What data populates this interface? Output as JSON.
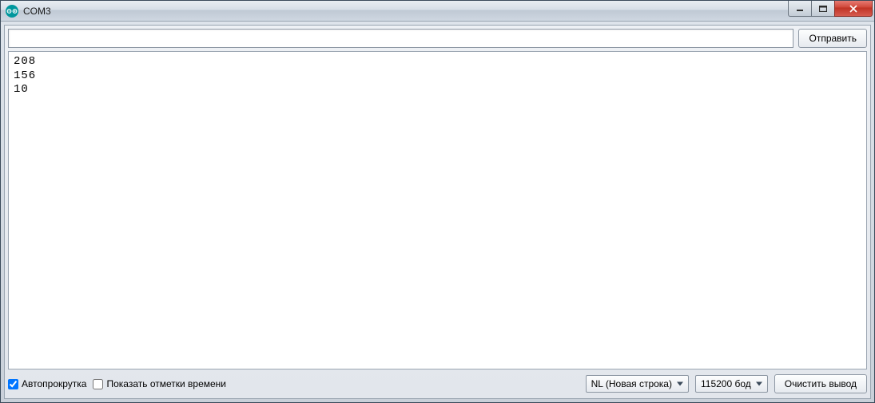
{
  "window": {
    "title": "COM3"
  },
  "top": {
    "input_value": "",
    "send_label": "Отправить"
  },
  "output_lines": [
    "208",
    "156",
    "10"
  ],
  "bottom": {
    "autoscroll_label": "Автопрокрутка",
    "autoscroll_checked": true,
    "timestamp_label": "Показать отметки времени",
    "timestamp_checked": false,
    "line_ending_selected": "NL (Новая строка)",
    "baud_selected": "115200 бод",
    "clear_label": "Очистить вывод"
  }
}
